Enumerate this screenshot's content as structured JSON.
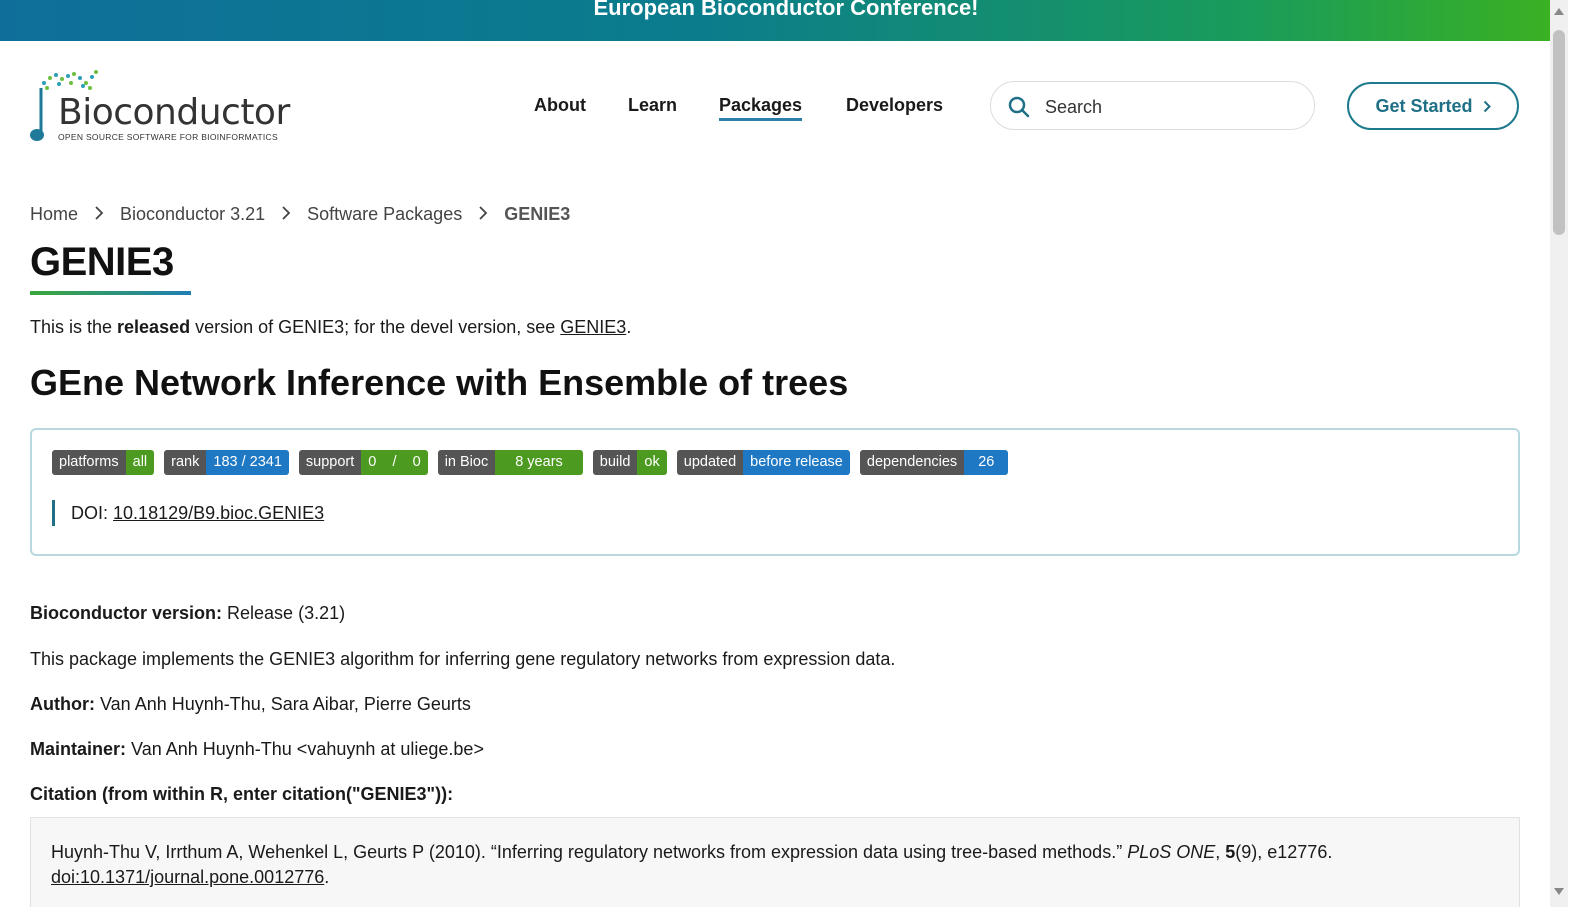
{
  "banner": {
    "text": "European Bioconductor Conference!"
  },
  "logo": {
    "name": "Bioconductor",
    "tagline": "OPEN SOURCE SOFTWARE FOR BIOINFORMATICS"
  },
  "nav": {
    "items": [
      {
        "label": "About"
      },
      {
        "label": "Learn"
      },
      {
        "label": "Packages",
        "active": true
      },
      {
        "label": "Developers"
      }
    ],
    "search_placeholder": "Search",
    "get_started": "Get Started"
  },
  "breadcrumb": [
    "Home",
    "Bioconductor 3.21",
    "Software Packages",
    "GENIE3"
  ],
  "package": {
    "name": "GENIE3",
    "release_note": {
      "prefix": "This is the ",
      "bold": "released",
      "middle": " version of GENIE3; for the devel version, see ",
      "link": "GENIE3",
      "suffix": "."
    },
    "title": "GEne Network Inference with Ensemble of trees",
    "badges": [
      {
        "key": "platforms",
        "value": "all",
        "color": "#4c9a1f"
      },
      {
        "key": "rank",
        "value": "183 / 2341",
        "color": "#1f78c4"
      },
      {
        "key": "support",
        "value": "0    /    0",
        "color": "#4c9a1f"
      },
      {
        "key": "in Bioc",
        "value": "8 years",
        "color": "#4c9a1f"
      },
      {
        "key": "build",
        "value": "ok",
        "color": "#4c9a1f"
      },
      {
        "key": "updated",
        "value": "before release",
        "color": "#1f78c4"
      },
      {
        "key": "dependencies",
        "value": "26",
        "color": "#1f78c4"
      }
    ],
    "doi_label": "DOI:",
    "doi": "10.18129/B9.bioc.GENIE3",
    "bioc_version_label": "Bioconductor version:",
    "bioc_version": "Release (3.21)",
    "description": "This package implements the GENIE3 algorithm for inferring gene regulatory networks from expression data.",
    "author_label": "Author:",
    "author": "Van Anh Huynh-Thu, Sara Aibar, Pierre Geurts",
    "maintainer_label": "Maintainer:",
    "maintainer": "Van Anh Huynh-Thu <vahuynh at uliege.be>",
    "citation_heading": "Citation (from within R, enter citation(\"GENIE3\")):",
    "citation": {
      "text": "Huynh-Thu V, Irrthum A, Wehenkel L, Geurts P (2010). “Inferring regulatory networks from expression data using tree-based methods.” ",
      "journal": "PLoS ONE",
      "sep": ", ",
      "volume": "5",
      "issue": "(9), e12776.",
      "doi_link": "doi:10.1371/journal.pone.0012776",
      "end": "."
    }
  },
  "colors": {
    "accent": "#1f6f86",
    "banner_start": "#0f6f9a",
    "banner_end": "#3cb21f"
  }
}
